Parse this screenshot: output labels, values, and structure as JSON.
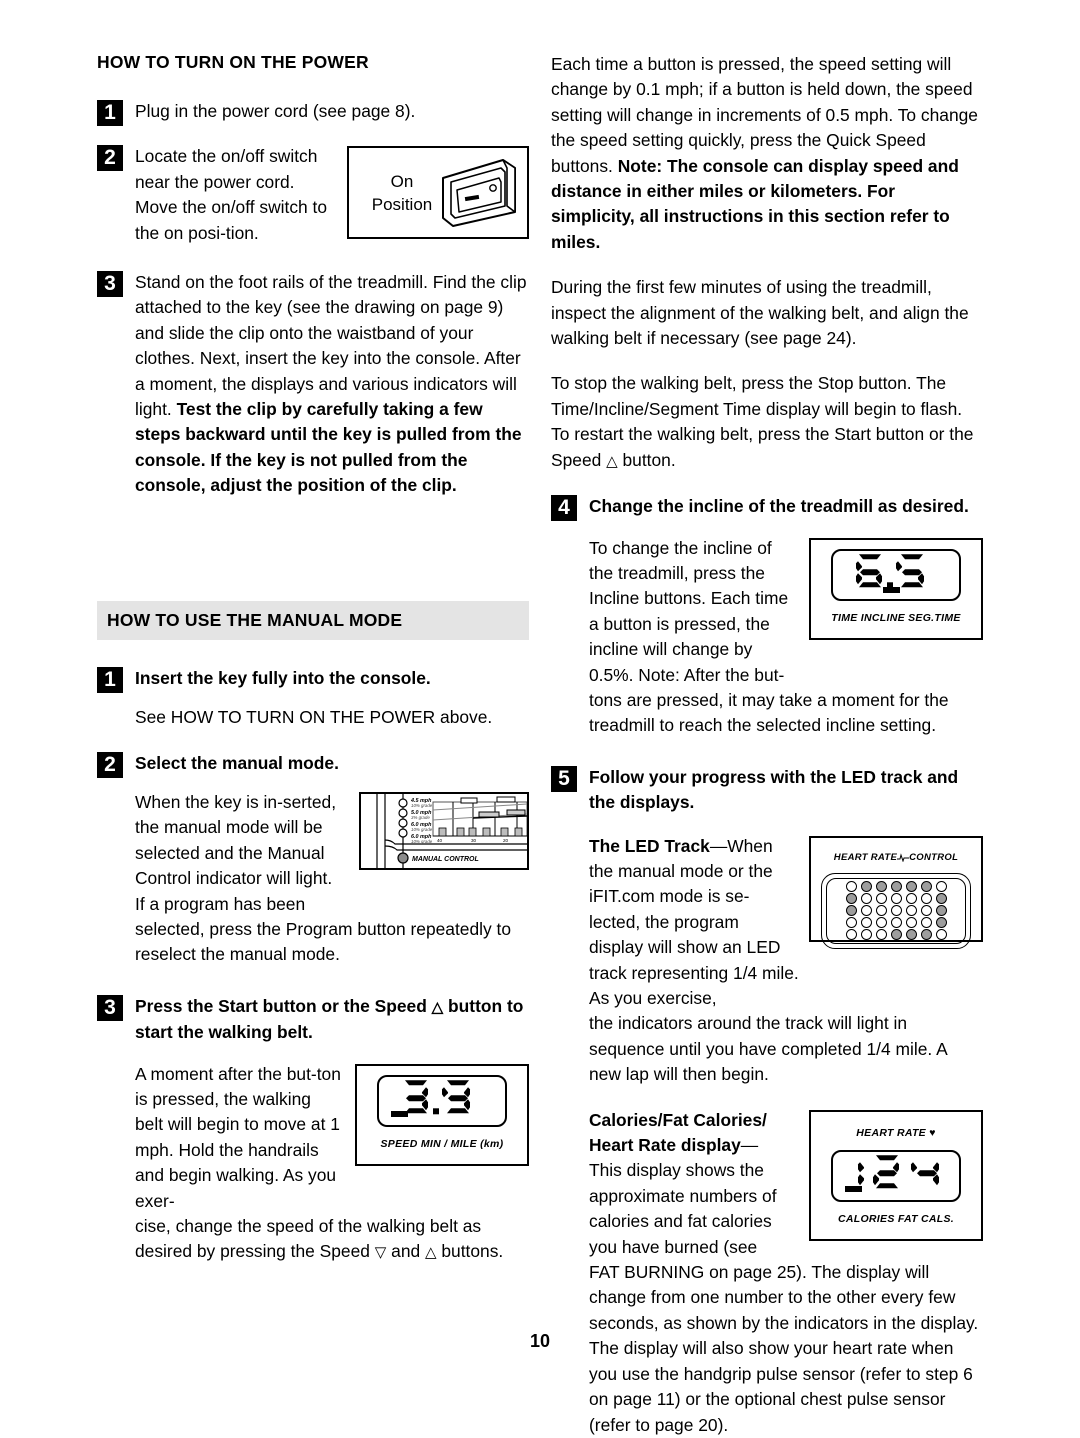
{
  "page": {
    "number": "10"
  },
  "left_column": {
    "section1": {
      "title": "HOW TO TURN ON THE POWER",
      "steps": [
        {
          "number": "1",
          "text": "Plug in the power cord (see page 8)."
        },
        {
          "number": "2",
          "text": "Locate the on/off switch near the power cord. Move the on/off switch to the on posi-tion."
        },
        {
          "number": "3",
          "text_regular": "Stand on the foot rails of the treadmill. Find the clip attached to the key (see the drawing on page 9) and slide the clip onto the waistband of your clothes. Next, insert the key into the console. After a moment, the displays and various indicators will light. ",
          "text_bold": "Test the clip by carefully taking a few steps backward until the key is pulled from the console. If the key is not pulled from the console, adjust the position of the clip."
        }
      ],
      "switch_figure": {
        "label_line1": "On",
        "label_line2": "Position"
      }
    },
    "section2": {
      "title": "HOW TO USE THE MANUAL MODE",
      "steps": [
        {
          "number": "1",
          "heading": "Insert the key fully into the console.",
          "text": "See HOW TO TURN ON THE POWER above."
        },
        {
          "number": "2",
          "heading": "Select the manual mode.",
          "text_wrap": "When the key is in-serted, the manual mode will be selected and the Manual Control indicator will light. If a program has been",
          "text_after": "selected, press the Program button repeatedly to reselect the manual mode."
        },
        {
          "number": "3",
          "heading_part1": "Press the Start button or the Speed ",
          "heading_tri": "△",
          "heading_part2": " button to start the walking belt.",
          "text_wrap": "A moment after the but-ton is pressed, the walking belt will begin to move at 1 mph. Hold the handrails and begin walking. As you exer-",
          "text_after_part1": "cise, change the speed of the walking belt as desired by pressing the Speed ",
          "text_after_tri1": "▽",
          "text_after_part2": " and ",
          "text_after_tri2": "△",
          "text_after_part3": " buttons."
        }
      ],
      "console_figure": {
        "indicator_label": "MANUAL CONTROL",
        "speed_labels": [
          {
            "speed": "4.5 mph",
            "grade": "10% grade"
          },
          {
            "speed": "5.0 mph",
            "grade": "3% grade"
          },
          {
            "speed": "6.0 mph",
            "grade": "10% grade"
          },
          {
            "speed": "6.0 mph",
            "grade": "10% grade"
          }
        ],
        "axis_ticks": [
          "40",
          "30",
          "20"
        ]
      },
      "speed_display": {
        "value": "3.9",
        "caption": "SPEED    MIN / MILE (km)"
      }
    }
  },
  "right_column": {
    "paragraphs": [
      {
        "regular_start": "Each time a button is pressed, the speed setting will change by 0.1 mph; if a button is held down, the speed setting will change in increments of 0.5 mph. To change the speed setting quickly, press the Quick Speed buttons. ",
        "bold_end": "Note: The console can display speed and distance in either miles or kilometers. For simplicity, all instructions in this section refer to miles."
      },
      {
        "text": "During the first few minutes of using the treadmill, inspect the alignment of the walking belt, and align the walking belt if necessary (see page 24)."
      },
      {
        "text_part1": "To stop the walking belt, press the Stop button. The Time/Incline/Segment Time display will begin to flash. To restart the walking belt, press the Start button or the Speed ",
        "tri": "△",
        "text_part2": " button."
      }
    ],
    "steps": [
      {
        "number": "4",
        "heading": "Change the incline of the treadmill as desired.",
        "text_wrap": "To change the incline of the treadmill, press the Incline buttons. Each time a button is pressed, the incline will change by 0.5%. Note: After the but-",
        "text_after": "tons are pressed, it may take a moment for the treadmill to reach the selected incline setting."
      },
      {
        "number": "5",
        "heading": "Follow your progress with the LED track and the displays.",
        "led_block": {
          "bold_lead": "The LED Track",
          "dash": "—",
          "text_wrap": "When the manual mode or the iFIT.com mode is se-lected, the program display will show an LED track representing 1/4 mile. As you exercise,",
          "text_after": "the indicators around the track will light in sequence until you have completed 1/4 mile. A new lap will then begin."
        },
        "calorie_block": {
          "bold_lead_line1": "Calories/Fat Calories/",
          "bold_lead_line2": "Heart Rate display",
          "dash": "—",
          "text_wrap": "This display shows the approximate numbers of calories and fat calories you have burned (see",
          "text_after": "FAT BURNING on page 25). The display will change from one number to the other every few seconds, as shown by the indicators in the display. The display will also show your heart rate when you use the handgrip pulse sensor (refer to step 6 on page 11) or the optional chest pulse sensor (refer to page 20)."
        }
      }
    ],
    "incline_display": {
      "value": "6.5",
      "caption": "TIME   INCLINE   SEG.TIME"
    },
    "led_track_display": {
      "label": "HEART RATE",
      "label_suffix": "CONTROL",
      "rows": [
        [
          0,
          1,
          1,
          1,
          1,
          1,
          0
        ],
        [
          1,
          0,
          0,
          0,
          0,
          0,
          1
        ],
        [
          1,
          0,
          0,
          0,
          0,
          0,
          1
        ],
        [
          0,
          0,
          0,
          0,
          0,
          0,
          1
        ],
        [
          0,
          0,
          0,
          1,
          1,
          1,
          0
        ]
      ]
    },
    "heart_rate_display": {
      "top_label": "HEART RATE",
      "heart_icon": "♥",
      "value": "124",
      "caption": "CALORIES       FAT CALS."
    }
  }
}
